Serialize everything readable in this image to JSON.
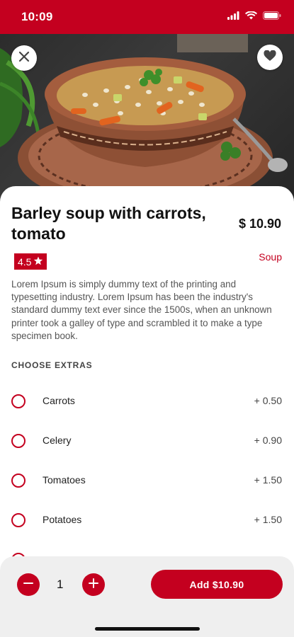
{
  "status": {
    "time": "10:09"
  },
  "icons": {
    "close": "close-icon",
    "favorite": "heart-icon",
    "rating_star": "star-icon",
    "minus": "minus-icon",
    "plus": "plus-icon"
  },
  "product": {
    "title": "Barley soup with carrots, tomato",
    "price": "$ 10.90",
    "rating": "4.5",
    "category": "Soup",
    "description": "Lorem Ipsum is simply dummy text of the printing and typesetting industry. Lorem Ipsum has been the industry's standard dummy text ever since the 1500s, when an unknown printer took a galley of type and scrambled it to make a type specimen book."
  },
  "extras": {
    "heading": "CHOOSE EXTRAS",
    "items": [
      {
        "name": "Carrots",
        "price": "+ 0.50"
      },
      {
        "name": "Celery",
        "price": "+ 0.90"
      },
      {
        "name": "Tomatoes",
        "price": "+ 1.50"
      },
      {
        "name": "Potatoes",
        "price": "+ 1.50"
      }
    ]
  },
  "cart": {
    "quantity": "1",
    "add_label": "Add $10.90"
  },
  "colors": {
    "accent": "#c4001f",
    "bottom_bar": "#efefef"
  }
}
